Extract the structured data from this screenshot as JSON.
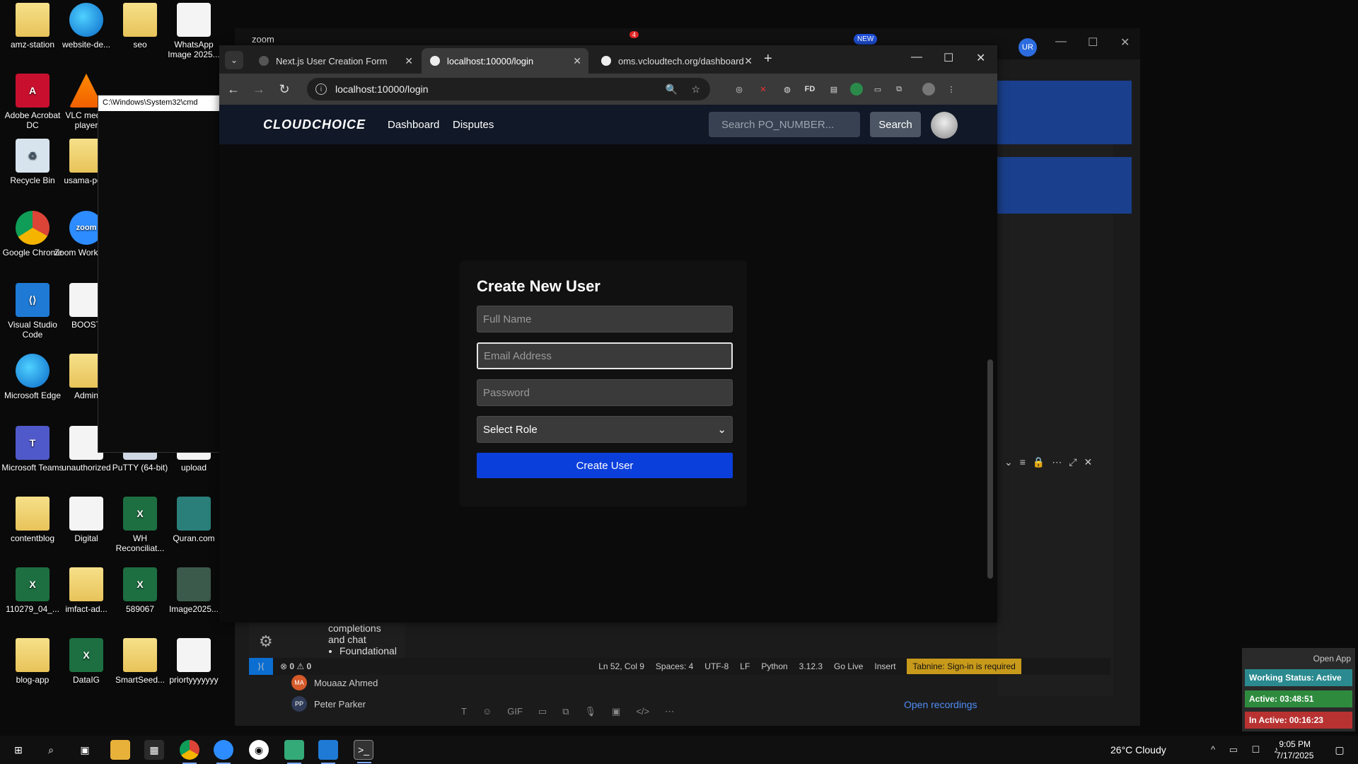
{
  "desktop": {
    "icons": [
      {
        "label": "amz-station",
        "type": "folder"
      },
      {
        "label": "website-de...",
        "type": "edge"
      },
      {
        "label": "seo",
        "type": "folder"
      },
      {
        "label": "WhatsApp Image 2025...",
        "type": "doc"
      },
      {
        "label": "Adobe Acrobat DC",
        "type": "pdf"
      },
      {
        "label": "VLC media player",
        "type": "vlc"
      },
      {
        "label": "Recycle Bin",
        "type": "recycle"
      },
      {
        "label": "usama-po...",
        "type": "folder"
      },
      {
        "label": "Google Chrome",
        "type": "chrome"
      },
      {
        "label": "Zoom Workplace",
        "type": "zoom"
      },
      {
        "label": "Visual Studio Code",
        "type": "vscode"
      },
      {
        "label": "BOOST",
        "type": "doc"
      },
      {
        "label": "Microsoft Edge",
        "type": "edge"
      },
      {
        "label": "Admin",
        "type": "folder"
      },
      {
        "label": "Microsoft Teams",
        "type": "teams"
      },
      {
        "label": "unauthorized",
        "type": "doc"
      },
      {
        "label": "PuTTY (64-bit)",
        "type": "putty"
      },
      {
        "label": "upload",
        "type": "doc"
      },
      {
        "label": "contentblog",
        "type": "folder"
      },
      {
        "label": "Digital",
        "type": "doc"
      },
      {
        "label": "WH Reconciliat...",
        "type": "excel"
      },
      {
        "label": "Quran.com",
        "type": "quran"
      },
      {
        "label": "110279_04_...",
        "type": "excel"
      },
      {
        "label": "imfact-ad...",
        "type": "folder"
      },
      {
        "label": "589067",
        "type": "excel"
      },
      {
        "label": "Image2025...",
        "type": "img"
      },
      {
        "label": "blog-app",
        "type": "folder"
      },
      {
        "label": "DataIG",
        "type": "excel"
      },
      {
        "label": "SmartSeed...",
        "type": "folder"
      },
      {
        "label": "priortyyyyyyy",
        "type": "doc"
      }
    ]
  },
  "cmd": {
    "title": "C:\\Windows\\System32\\cmd"
  },
  "zoom": {
    "title": "zoom",
    "new_badge": "NEW",
    "notify_count": "4",
    "avatar": "UR",
    "chat_users": [
      {
        "initials": "MA",
        "name": "Mouaaz Ahmed"
      },
      {
        "initials": "PP",
        "name": "Peter Parker"
      }
    ],
    "open_recordings": "Open recordings"
  },
  "vscode": {
    "status": {
      "errors": "0",
      "warnings": "0",
      "position": "Ln 52, Col 9",
      "spaces": "Spaces: 4",
      "encoding": "UTF-8",
      "eol": "LF",
      "language": "Python",
      "version": "3.12.3",
      "go_live": "Go Live",
      "insert": "Insert",
      "tabnine": "Tabnine: Sign-in is required"
    },
    "side_items": [
      "completions",
      "and chat",
      "Foundational"
    ]
  },
  "chrome": {
    "tabs": [
      {
        "title": "Next.js User Creation Form"
      },
      {
        "title": "localhost:10000/login"
      },
      {
        "title": "oms.vcloudtech.org/dashboard"
      }
    ],
    "url": "localhost:10000/login"
  },
  "site": {
    "logo": "CLOUDCHOICE",
    "nav": [
      "Dashboard",
      "Disputes"
    ],
    "search_placeholder": "Search PO_NUMBER...",
    "search_button": "Search"
  },
  "form": {
    "title": "Create New User",
    "full_name_placeholder": "Full Name",
    "email_placeholder": "Email Address",
    "password_placeholder": "Password",
    "role_selected": "Select Role",
    "submit": "Create User"
  },
  "monitor": {
    "open_app": "Open App",
    "status": "Working Status: Active",
    "active": "Active: 03:48:51",
    "inactive": "In Active: 00:16:23",
    "colors": {
      "status": "#2a8a8f",
      "active": "#2e8b3e",
      "inactive": "#b83232"
    }
  },
  "taskbar": {
    "weather": "26°C  Cloudy",
    "time": "9:05 PM",
    "date": "7/17/2025"
  }
}
